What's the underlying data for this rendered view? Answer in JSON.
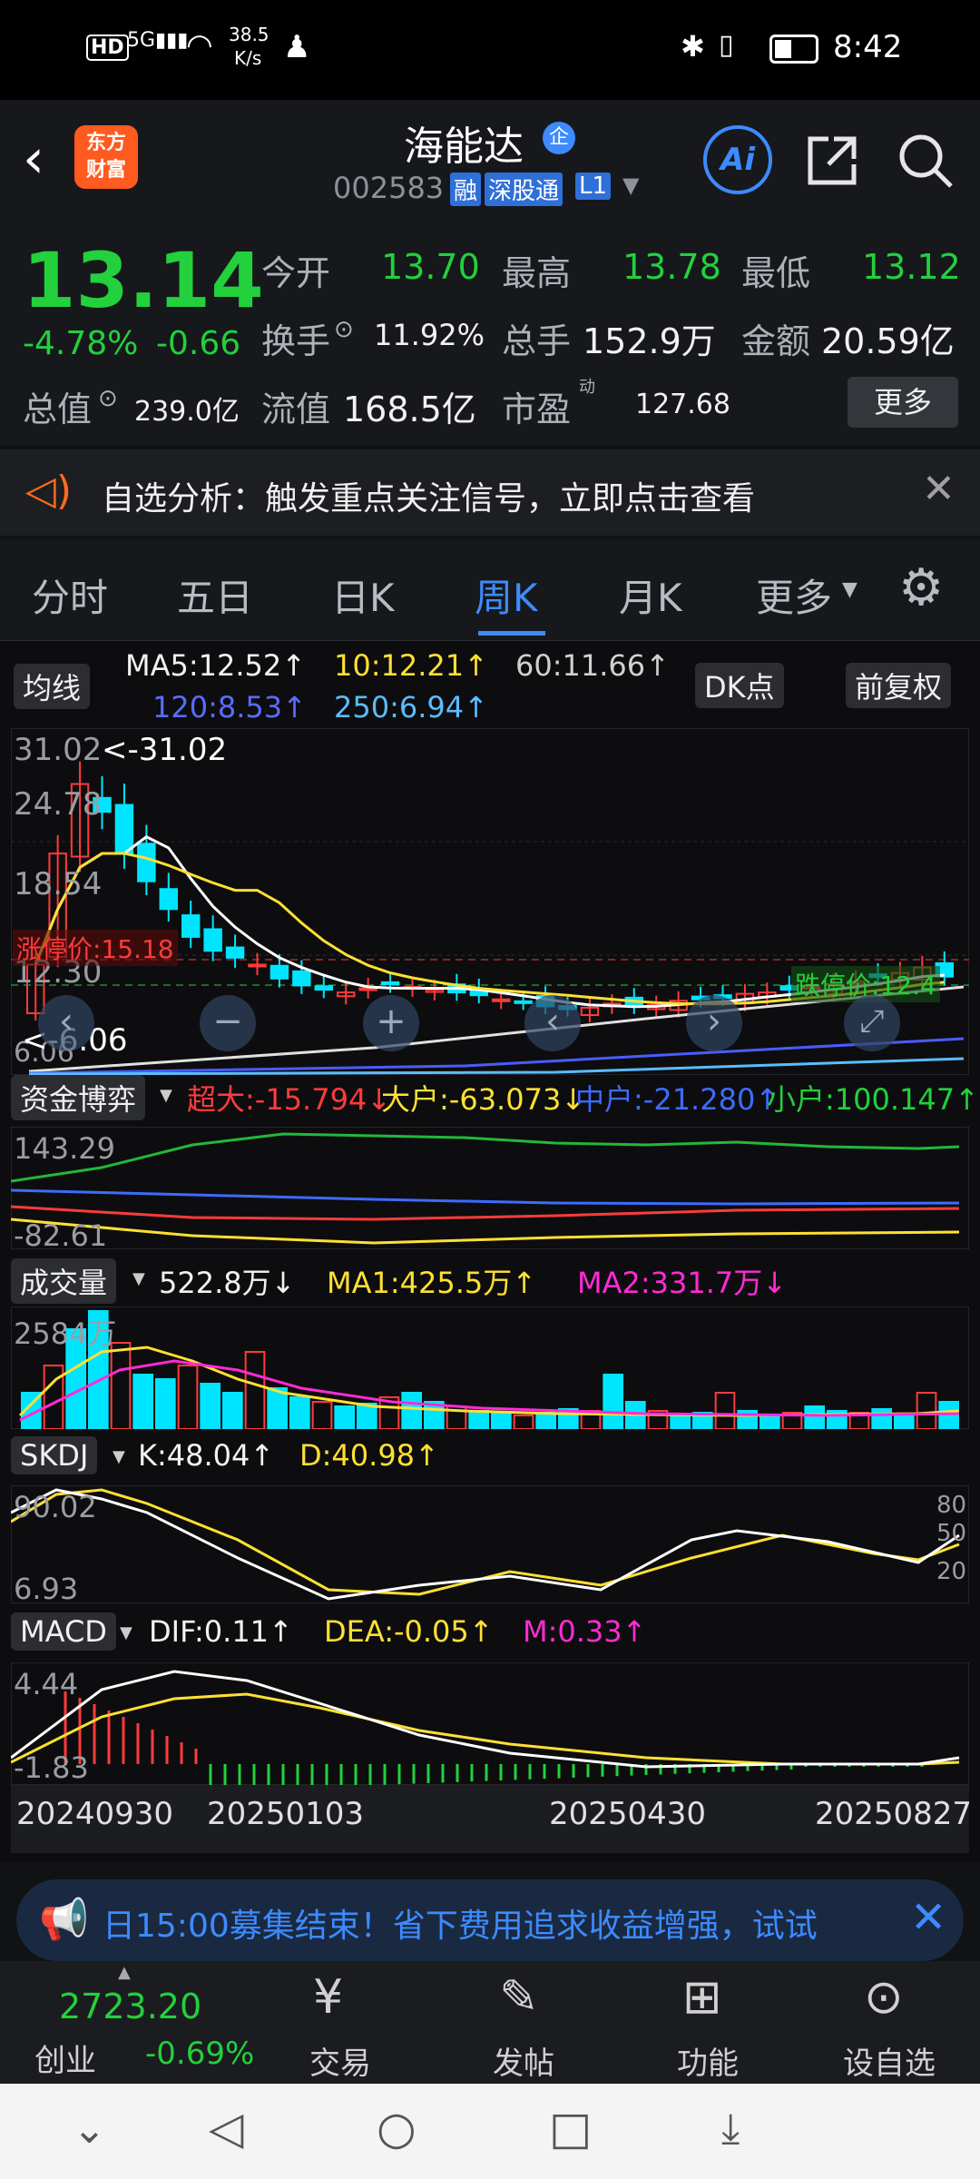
{
  "status_bar": {
    "hd": "HD",
    "net_speed_top": "38.5",
    "net_speed_unit": "K/s",
    "time": "8:42"
  },
  "header": {
    "back_icon": "chevron-left-icon",
    "app_badge": "东方\n财富",
    "stock_name": "海能达",
    "stock_code": "002583",
    "tags": [
      "融",
      "深股通",
      "L1"
    ],
    "ai_label": "Ai"
  },
  "quote": {
    "price": "13.14",
    "change_pct": "-4.78%",
    "change_amt": "-0.66",
    "open_label": "今开",
    "open": "13.70",
    "high_label": "最高",
    "high": "13.78",
    "low_label": "最低",
    "low": "13.12",
    "turnover_label": "换手",
    "turnover": "11.92%",
    "volume_label": "总手",
    "volume": "152.9万",
    "amount_label": "金额",
    "amount": "20.59亿",
    "mktcap_label": "总值",
    "mktcap": "239.0亿",
    "float_label": "流值",
    "float_val": "168.5亿",
    "pe_label": "市盈",
    "pe_sup": "动",
    "pe": "127.68",
    "more_label": "更多"
  },
  "notice": {
    "text": "自选分析：触发重点关注信号，立即点击查看"
  },
  "tabs": [
    "分时",
    "五日",
    "日K",
    "周K",
    "月K",
    "更多"
  ],
  "active_tab": "周K",
  "main_chart": {
    "ma_button": "均线",
    "ma5": "MA5:12.52↑",
    "ma10": "10:12.21↑",
    "ma60": "60:11.66↑",
    "ma120": "120:8.53↑",
    "ma250": "250:6.94↑",
    "dk_button": "DK点",
    "adjust_button": "前复权",
    "y_top": "31.02",
    "y_2": "24.78",
    "y_3": "18.54",
    "y_4": "12.30",
    "y_bottom": "6.06",
    "max_marker": "<-31.02",
    "min_marker": "<-6.06",
    "limit_up": "涨停价:15.18",
    "limit_down": "跌停价:12.4"
  },
  "fund_flow": {
    "button": "资金博弈",
    "super": "超大:-15.794↓",
    "large": "大户:-63.073↓",
    "medium": "中户:-21.280↑",
    "small": "小户:100.147↑",
    "y_top": "143.29",
    "y_bottom": "-82.61"
  },
  "volume": {
    "button": "成交量",
    "value": "522.8万↓",
    "ma1": "MA1:425.5万↑",
    "ma2": "MA2:331.7万↓",
    "y_top": "2584万"
  },
  "skdj": {
    "button": "SKDJ",
    "k": "K:48.04↑",
    "d": "D:40.98↑",
    "y_top": "90.02",
    "y_bottom": "6.93",
    "r80": "80",
    "r50": "50",
    "r20": "20"
  },
  "macd": {
    "button": "MACD",
    "dif": "DIF:0.11↑",
    "dea": "DEA:-0.05↑",
    "m": "M:0.33↑",
    "y_top": "4.44",
    "y_bottom": "-1.83"
  },
  "dates": [
    "20240930",
    "20250103",
    "20250430",
    "20250827"
  ],
  "banner": {
    "text": "日15:00募集结束！省下费用追求收益增强，试试"
  },
  "bottom_bar": {
    "index_value": "2723.20",
    "index_name": "创业",
    "index_change": "-0.69%",
    "items": [
      "交易",
      "发帖",
      "功能",
      "设自选"
    ]
  },
  "colors": {
    "up": "#ff3b3b",
    "down": "#22d13c",
    "accent": "#3d8bff",
    "yellow": "#ffe033",
    "magenta": "#ff2bd6",
    "cyan": "#00e5ff"
  }
}
